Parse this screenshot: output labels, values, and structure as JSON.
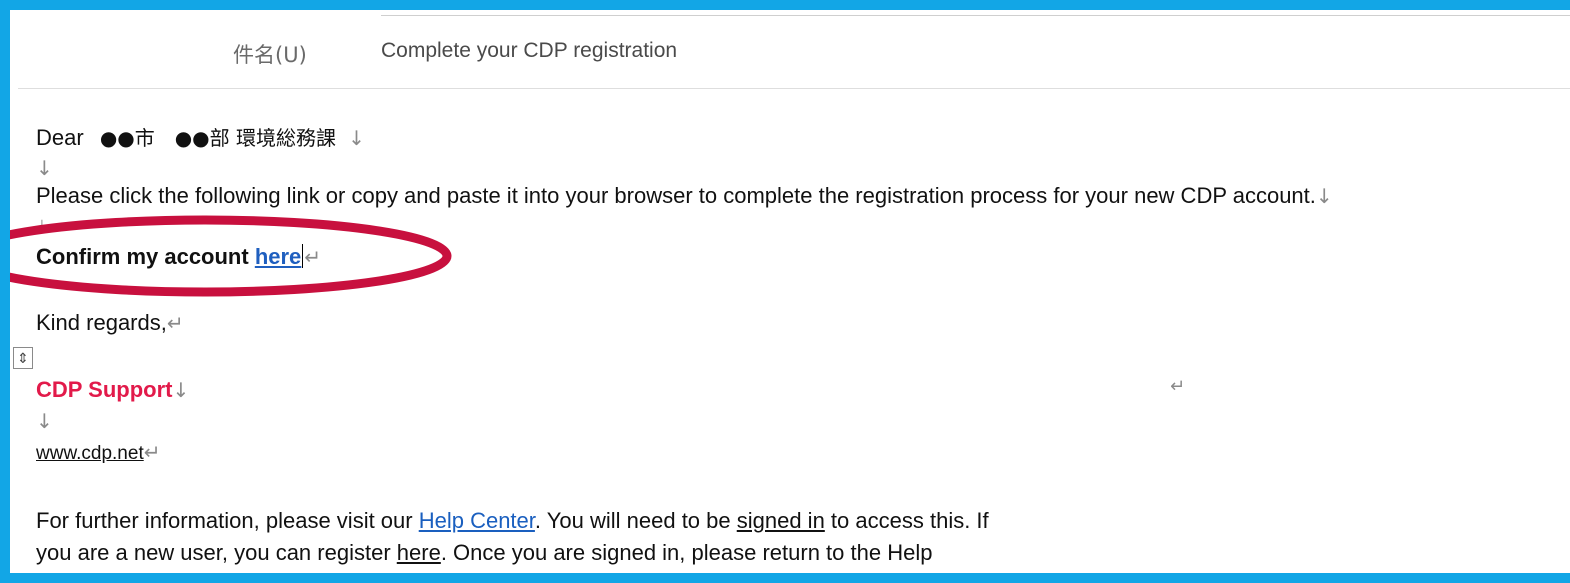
{
  "header": {
    "subject_label": "件名(U)",
    "subject_value": "Complete your CDP registration"
  },
  "body": {
    "greeting_prefix": "Dear",
    "greeting_org": "●●市　●●部 環境総務課",
    "instruction": "Please click the following link or copy and paste it into your browser to complete the registration process for your new CDP account.",
    "confirm_text": "Confirm my account ",
    "confirm_link": "here",
    "regards": "Kind regards,",
    "signature": "CDP Support",
    "website": "www.cdp.net",
    "info_line1_a": "For further information, please visit our ",
    "help_center_link": "Help Center",
    "info_line1_b": ". You will need to be ",
    "signed_in_link": "signed in",
    "info_line1_c": " to access this. If",
    "info_line2_a": "you are a new user, you can register ",
    "register_link": "here",
    "info_line2_b": ". Once you are signed in, please return to the Help"
  },
  "marks": {
    "line_break": "↓",
    "paragraph": "↵",
    "move_handle": "⇕"
  },
  "colors": {
    "frame": "#12a6e6",
    "highlight_ellipse": "#c8103e",
    "signature": "#e21a4a",
    "link": "#1a5fbf"
  }
}
